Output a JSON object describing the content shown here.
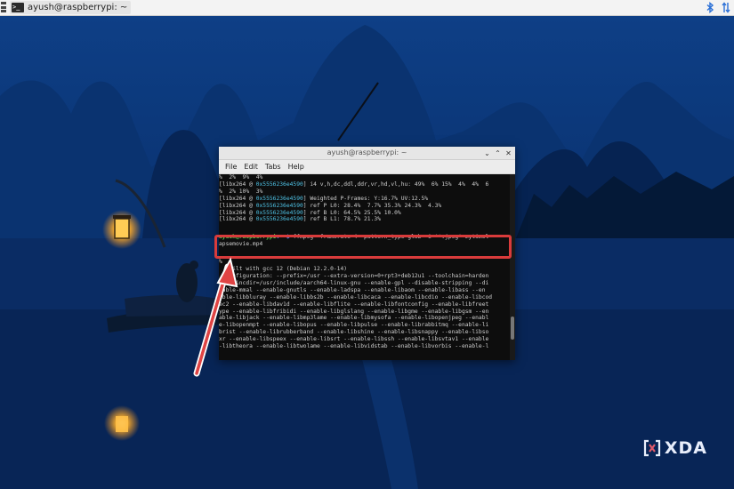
{
  "taskbar": {
    "window_title": "ayush@raspberrypi: ~",
    "terminal_icon_glyph": ">_"
  },
  "terminal": {
    "title": "ayush@raspberrypi: ~",
    "menu": [
      "File",
      "Edit",
      "Tabs",
      "Help"
    ],
    "output_top": [
      "%  2%  9%  4%",
      "[libx264 @ 0x5556236e4590] i4 v,h,dc,ddl,ddr,vr,hd,vl,hu: 49%  6% 15%  4%  4%  6",
      "%  2% 10%  3%",
      "[libx264 @ 0x5556236e4590] Weighted P-Frames: Y:16.7% UV:12.5%",
      "[libx264 @ 0x5556236e4590] ref P L0: 28.4%  7.7% 35.3% 24.3%  4.3%",
      "[libx264 @ 0x5556236e4590] ref B L0: 64.5% 25.5% 10.0%",
      "[libx264 @ 0x5556236e4590] ref B L1: 78.7% 21.3%"
    ],
    "prompt_user": "ayush@raspberrypi",
    "prompt_path": ":~ $",
    "command": " ffmpeg -framerate 4 -pattern_type glob -i '*.jpeg' mytimel",
    "command_wrap": "apsemovie.mp4",
    "output_bottom": [
      "%",
      "  built with gcc 12 (Debian 12.2.0-14)",
      "  configuration: --prefix=/usr --extra-version=0+rpt3+deb12u1 --toolchain=harden",
      "ed --incdir=/usr/include/aarch64-linux-gnu --enable-gpl --disable-stripping --di",
      "sable-mmal --enable-gnutls --enable-ladspa --enable-libaom --enable-libass --en",
      "able-libbluray --enable-libbs2b --enable-libcaca --enable-libcdio --enable-libcod",
      "ec2 --enable-libdav1d --enable-libflite --enable-libfontconfig --enable-libfreet",
      "ype --enable-libfribidi --enable-libglslang --enable-libgme --enable-libgsm --en",
      "able-libjack --enable-libmp3lame --enable-libmysofa --enable-libopenjpeg --enabl",
      "e-libopenmpt --enable-libopus --enable-libpulse --enable-librabbitmq --enable-li",
      "brist --enable-librubberband --enable-libshine --enable-libsnappy --enable-libso",
      "xr --enable-libspeex --enable-libsrt --enable-libssh --enable-libsvtav1 --enable",
      "-libtheora --enable-libtwolame --enable-libvidstab --enable-libvorbis --enable-l"
    ]
  },
  "watermark": {
    "text": "XDA"
  },
  "colors": {
    "highlight": "#d93b3b",
    "prompt_user": "#4fd14f",
    "prompt_path": "#5a8cff",
    "hex_address": "#4fc3e6"
  },
  "icons": {
    "app_menu": "app-menu-icon",
    "bluetooth": "bluetooth-icon",
    "network": "network-transfer-icon",
    "minimize": "minimize-icon",
    "maximize": "maximize-icon",
    "close": "close-icon"
  }
}
